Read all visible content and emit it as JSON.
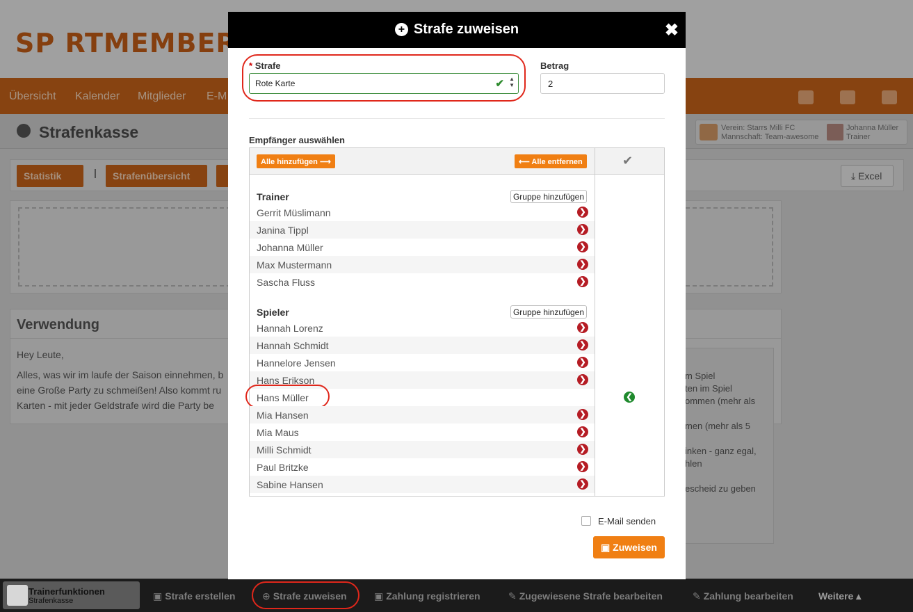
{
  "app": {
    "logo_text": "SP RTMEMBER"
  },
  "nav": {
    "items": [
      {
        "label": "Übersicht"
      },
      {
        "label": "Kalender"
      },
      {
        "label": "Mitglieder"
      },
      {
        "label": "E-M"
      }
    ]
  },
  "page": {
    "title": "Strafenkasse"
  },
  "context": {
    "verein": "Verein: Starrs Milli FC",
    "mannschaft": "Mannschaft: Team-awesome",
    "user_name": "Johanna Müller",
    "user_role": "Trainer"
  },
  "toolbar": {
    "statistik": "Statistik",
    "strafenuebersicht": "Strafenübersicht",
    "excel": "Excel"
  },
  "verwendung": {
    "title": "Verwendung",
    "greeting": "Hey Leute,",
    "lines": [
      "Alles, was wir im laufe der Saison einnehmen, b",
      "eine Große Party zu schmeißen! Also kommt ru",
      "Karten - mit jeder Geldstrafe wird die Party be"
    ]
  },
  "rules_fragments": [
    "m Spiel",
    "ten im Spiel",
    "ommen (mehr als",
    "",
    "men (mehr als 5",
    "",
    "inken - ganz egal,",
    "hlen",
    "",
    "escheid zu geben"
  ],
  "modal": {
    "title": "Strafe zuweisen",
    "close": "✖",
    "strafe_label": "Strafe",
    "strafe_required": "*",
    "strafe_value": "Rote Karte",
    "betrag_label": "Betrag",
    "betrag_value": "2",
    "empfaenger_label": "Empfänger auswählen",
    "add_all": "Alle hinzufügen ⟶",
    "remove_all": "⟵ Alle entfernen",
    "group_button": "Gruppe hinzufügen",
    "groups": [
      {
        "name": "Trainer",
        "members": [
          "Gerrit Müslimann",
          "Janina Tippl",
          "Johanna Müller",
          "Max Mustermann",
          "Sascha Fluss"
        ]
      },
      {
        "name": "Spieler",
        "members": [
          "Hannah Lorenz",
          "Hannah Schmidt",
          "Hannelore Jensen",
          "Hans Erikson",
          "Hans Müller",
          "Mia Hansen",
          "Mia Maus",
          "Milli Schmidt",
          "Paul Britzke",
          "Sabine Hansen"
        ]
      }
    ],
    "selected": [
      "Hans Müller"
    ],
    "email_label": "E-Mail senden",
    "submit": "Zuweisen"
  },
  "bottom_bar": {
    "trainerfunktionen": "Trainerfunktionen",
    "strafenkasse": "Strafenkasse",
    "items": [
      {
        "label": "Strafe erstellen"
      },
      {
        "label": "Strafe zuweisen"
      },
      {
        "label": "Zahlung registrieren"
      },
      {
        "label": "Zugewiesene Strafe bearbeiten"
      },
      {
        "label": "Zahlung bearbeiten"
      },
      {
        "label": "Weitere ▴"
      }
    ]
  },
  "colors": {
    "accent": "#f07f13",
    "danger": "#b51c24",
    "success": "#1f8a2d",
    "highlight": "#e0271b"
  }
}
